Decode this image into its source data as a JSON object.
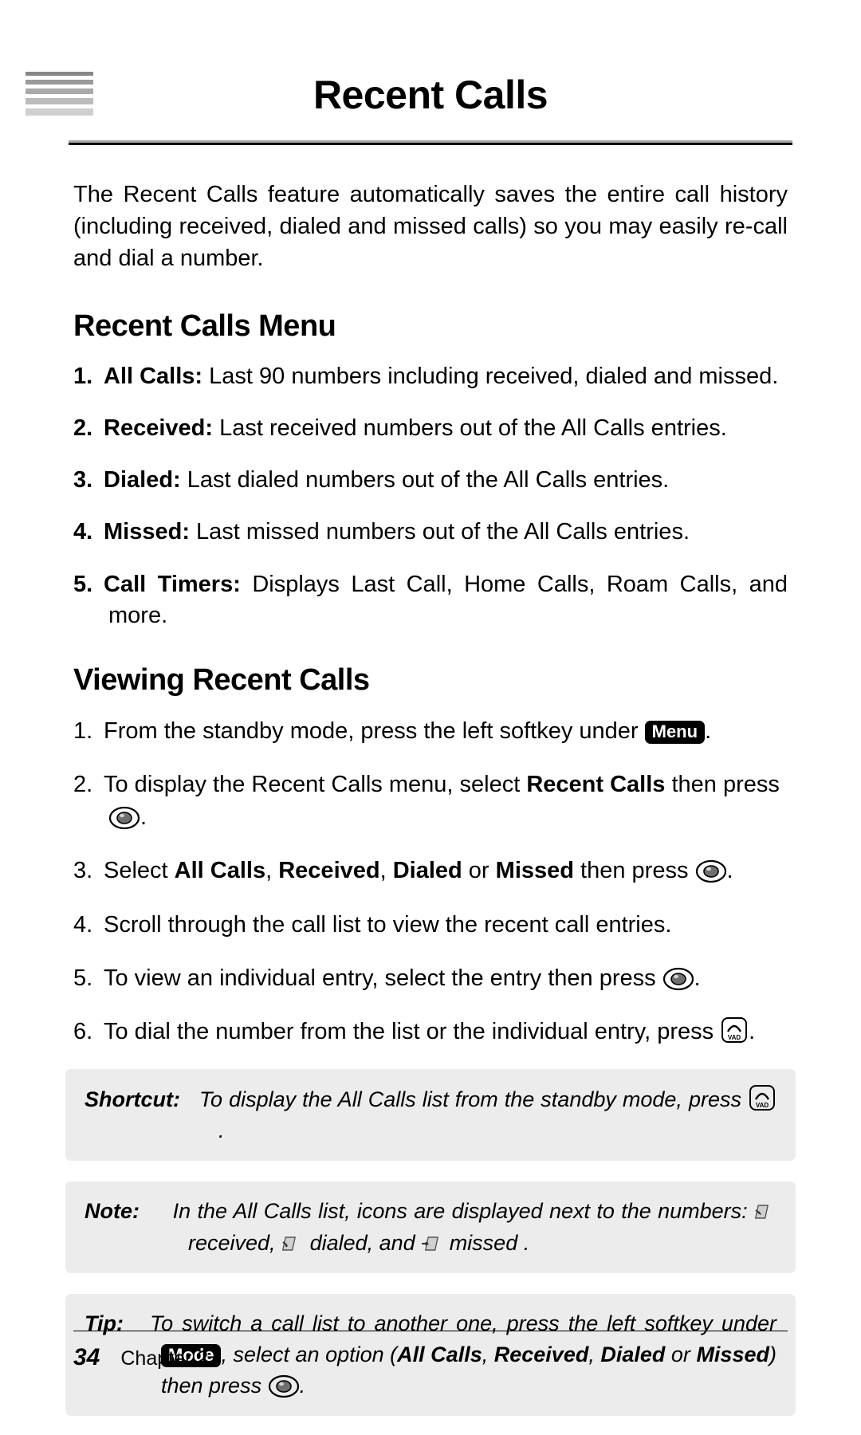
{
  "title": "Recent Calls",
  "intro": "The Recent Calls feature automatically saves the entire call history (including received, dialed and missed calls) so you may easily re-call and dial a number.",
  "h2_menu": "Recent Calls Menu",
  "menu_items": [
    {
      "n": "1.",
      "label": "All Calls:",
      "desc": " Last 90 numbers including received, dialed and missed."
    },
    {
      "n": "2.",
      "label": "Received:",
      "desc": " Last received numbers out of the All Calls entries."
    },
    {
      "n": "3.",
      "label": "Dialed:",
      "desc": " Last dialed numbers out of the All Calls entries."
    },
    {
      "n": "4.",
      "label": "Missed:",
      "desc": " Last missed numbers out of the All Calls entries."
    },
    {
      "n": "5.",
      "label": "Call Timers:",
      "desc": " Displays Last Call, Home Calls, Roam Calls, and more."
    }
  ],
  "h2_viewing": "Viewing Recent Calls",
  "steps": {
    "s1a": "From the standby mode, press the left softkey under ",
    "s1key": "Menu",
    "s1b": ".",
    "s2a": "To display the Recent Calls menu, select ",
    "s2bold": "Recent Calls",
    "s2b": " then press ",
    "s2c": ".",
    "s3a": "Select ",
    "s3b1": "All Calls",
    "s3c1": ", ",
    "s3b2": "Received",
    "s3c2": ", ",
    "s3b3": "Dialed",
    "s3c3": " or ",
    "s3b4": "Missed",
    "s3d": " then press ",
    "s3e": ".",
    "s4": "Scroll through the call list to view the recent call entries.",
    "s5a": "To view an individual entry, select the entry then press ",
    "s5b": ".",
    "s6a": "To dial the number from the list or the individual entry, press ",
    "s6b": "."
  },
  "shortcut": {
    "label": "Shortcut:",
    "text_a": "To display the All Calls list from the standby mode, press ",
    "text_b": "."
  },
  "note": {
    "label": "Note:",
    "line1": "In the All Calls list, icons are displayed next to the numbers: ",
    "w_received": " received, ",
    "w_dialed": " dialed, and ",
    "w_missed": " missed ."
  },
  "tip": {
    "label": "Tip:",
    "a": "To switch a call list to another one, press the left softkey under ",
    "key": "Mode",
    "b": ", select an option (",
    "o1": "All Calls",
    "c1": ", ",
    "o2": "Received",
    "c2": ", ",
    "o3": "Dialed",
    "c3": " or ",
    "o4": "Missed",
    "d": ") then press ",
    "e": "."
  },
  "footer": {
    "page": "34",
    "chapter": "Chapter 2"
  }
}
